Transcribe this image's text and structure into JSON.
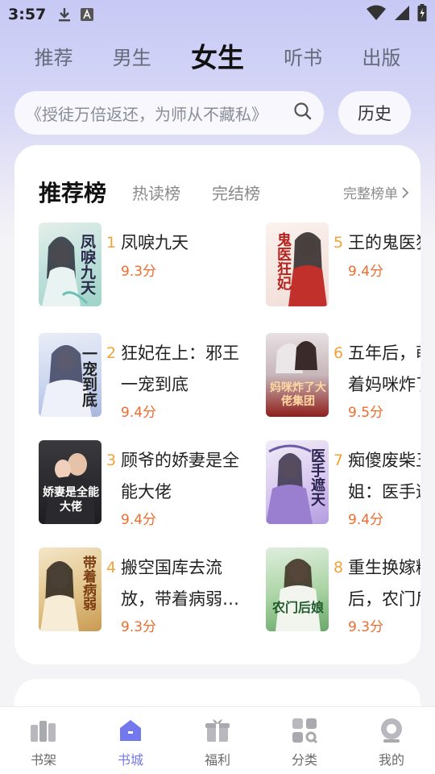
{
  "status_bar": {
    "time": "3:57"
  },
  "top_tabs": [
    "推荐",
    "男生",
    "女生",
    "听书",
    "出版"
  ],
  "active_top_tab": "女生",
  "search": {
    "placeholder": "《授徒万倍返还，为师从不藏私》",
    "history_label": "历史"
  },
  "ranking": {
    "tabs": [
      "推荐榜",
      "热读榜",
      "完结榜"
    ],
    "full_list_label": "完整榜单",
    "books": [
      {
        "rank": "1",
        "title": "凤唳九天",
        "score": "9.3分",
        "cover_text": "凤唳九天"
      },
      {
        "rank": "2",
        "title": "狂妃在上：邪王一宠到底",
        "score": "9.4分",
        "cover_text": "一宠到底"
      },
      {
        "rank": "3",
        "title": "顾爷的娇妻是全能大佬",
        "score": "9.4分",
        "cover_text": "娇妻是全能大佬"
      },
      {
        "rank": "4",
        "title": "搬空国库去流放，带着病弱…",
        "score": "9.3分",
        "cover_text": "带着病弱"
      },
      {
        "rank": "5",
        "title": "王的鬼医狂妃",
        "score": "9.4分",
        "cover_text": "鬼医狂妃"
      },
      {
        "rank": "6",
        "title": "五年后，萌宝带着妈咪炸了大佬集团",
        "score": "9.5分",
        "cover_text": "妈咪炸了大佬集团"
      },
      {
        "rank": "7",
        "title": "痴傻废柴五小姐：医手遮天",
        "score": "9.4分",
        "cover_text": "医手遮天"
      },
      {
        "rank": "8",
        "title": "重生换嫁糙汉后，农门后娘",
        "score": "9.3分",
        "cover_text": "农门后娘"
      }
    ]
  },
  "bottom_nav": [
    "书架",
    "书城",
    "福利",
    "分类",
    "我的"
  ],
  "active_nav": "书城",
  "colors": {
    "accent": "#7478ee",
    "score": "#ef6c2f",
    "rank_number": "#f2a23a"
  }
}
